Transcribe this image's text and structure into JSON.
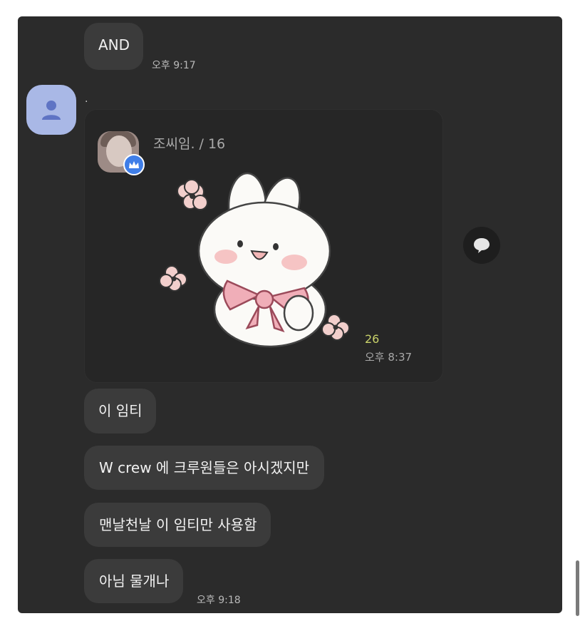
{
  "messages": [
    {
      "text": "AND",
      "time": "오후 9:17"
    },
    {
      "text": "이 임티"
    },
    {
      "text": "W crew 에 크루원들은 아시겠지만"
    },
    {
      "text": "맨날천날 이 임티만 사용함"
    },
    {
      "text": "아님 물개나",
      "time": "오후 9:18"
    }
  ],
  "sender": {
    "name_marker": "."
  },
  "sticker_card": {
    "title": "조씨임. / 16",
    "count": "26",
    "time": "오후 8:37"
  },
  "icons": {
    "avatar": "person-icon",
    "crown": "crown-icon",
    "reply": "speech-bubble-icon",
    "sticker": "bunny-sticker"
  },
  "colors": {
    "background": "#2b2b2b",
    "bubble": "#3b3b3b",
    "avatar": "#a9b8e6",
    "count": "#c9d26a",
    "crown": "#3f7ee8"
  }
}
